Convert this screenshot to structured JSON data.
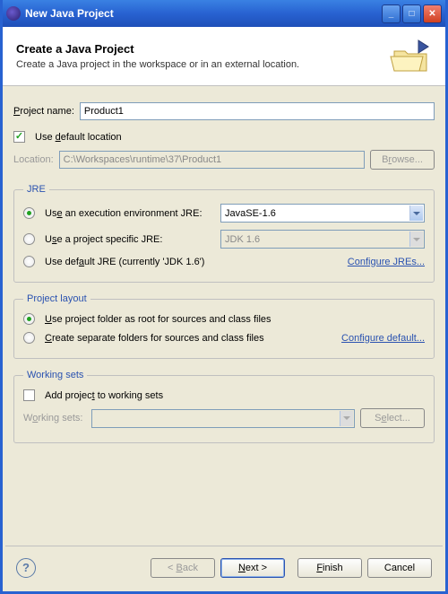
{
  "window": {
    "title": "New Java Project"
  },
  "banner": {
    "heading": "Create a Java Project",
    "subheading": "Create a Java project in the workspace or in an external location."
  },
  "projectName": {
    "label": "Project name:",
    "value": "Product1"
  },
  "useDefaultLocation": {
    "label": "Use default location",
    "checked": true
  },
  "location": {
    "label": "Location:",
    "value": "C:\\Workspaces\\runtime\\37\\Product1",
    "browse": "Browse..."
  },
  "jre": {
    "legend": "JRE",
    "exec": {
      "label": "Use an execution environment JRE:",
      "value": "JavaSE-1.6"
    },
    "proj": {
      "label": "Use a project specific JRE:",
      "value": "JDK 1.6"
    },
    "def": {
      "label": "Use default JRE (currently 'JDK 1.6')"
    },
    "configure": "Configure JREs..."
  },
  "layout": {
    "legend": "Project layout",
    "root": "Use project folder as root for sources and class files",
    "sep": "Create separate folders for sources and class files",
    "configure": "Configure default..."
  },
  "workingSets": {
    "legend": "Working sets",
    "add": "Add project to working sets",
    "label": "Working sets:",
    "select": "Select..."
  },
  "footer": {
    "back": "< Back",
    "next": "Next >",
    "finish": "Finish",
    "cancel": "Cancel"
  }
}
